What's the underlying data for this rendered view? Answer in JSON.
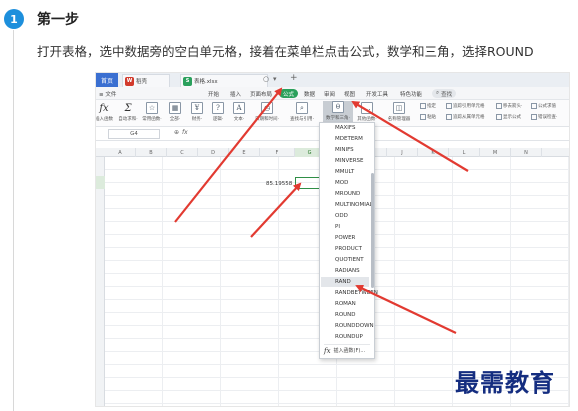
{
  "step": {
    "number": "1",
    "title": "第一步",
    "description": "打开表格，选中数据旁的空白单元格，接着在菜单栏点击公式，数学和三角，选择ROUND"
  },
  "app": {
    "home_tab": "首页",
    "tabs": [
      {
        "icon_text": "W",
        "label": "稻壳",
        "icon": "wps-logo-icon"
      },
      {
        "icon_text": "S",
        "label": "表格.xlsx",
        "icon": "spreadsheet-file-icon"
      }
    ],
    "tab_controls": {
      "dot": "○",
      "chevron": "▾",
      "add": "+"
    },
    "menu": {
      "file": "≡ 文件",
      "items": [
        "开始",
        "插入",
        "页面布局",
        "公式",
        "数据",
        "审阅",
        "视图",
        "开发工具",
        "特色功能"
      ],
      "active": "公式",
      "search": "查找"
    },
    "ribbon": {
      "buttons": [
        {
          "glyph": "fx",
          "label": "插入函数"
        },
        {
          "glyph": "Σ",
          "label": "自动求和·"
        },
        {
          "glyph": "☆",
          "label": "常用函数·"
        },
        {
          "glyph": "▦",
          "label": "全部·"
        },
        {
          "glyph": "¥",
          "label": "财务·"
        },
        {
          "glyph": "?",
          "label": "逻辑·"
        },
        {
          "glyph": "A",
          "label": "文本·"
        },
        {
          "glyph": "◷",
          "label": "日期和时间·"
        },
        {
          "glyph": "⌕",
          "label": "查找与引用·"
        },
        {
          "glyph": "θ",
          "label": "数学和三角·"
        },
        {
          "glyph": "…",
          "label": "其他函数·"
        },
        {
          "glyph": "◫",
          "label": "名称管理器"
        }
      ],
      "small_items": [
        "指定",
        "粘贴",
        "追踪引用单元格",
        "追踪从属单元格",
        "移去箭头·",
        "显示公式",
        "公式求值",
        "错误检查·"
      ]
    },
    "formula_bar": {
      "name_box": "G4",
      "zoom_icon": "⊕",
      "fx": "fx"
    },
    "columns": [
      "A",
      "B",
      "C",
      "D",
      "E",
      "F",
      "G",
      "H",
      "I",
      "J",
      "K",
      "L",
      "M",
      "N"
    ],
    "cell_value": "85.19558",
    "dropdown": {
      "items": [
        "MAXIFS",
        "MDETERM",
        "MINIFS",
        "MINVERSE",
        "MMULT",
        "MOD",
        "MROUND",
        "MULTINOMIAL",
        "ODD",
        "PI",
        "POWER",
        "PRODUCT",
        "QUOTIENT",
        "RADIANS",
        "RAND",
        "RANDBETWEEN",
        "ROMAN",
        "ROUND",
        "ROUNDDOWN",
        "ROUNDUP"
      ],
      "highlighted": "RAND",
      "footer_icon": "fx",
      "footer": "插入函数(F)..."
    }
  },
  "watermark": "最需教育",
  "colors": {
    "badge": "#1d8fdc",
    "active_menu": "#2aa05c",
    "arrow": "#e23a31",
    "watermark": "#142d80"
  }
}
